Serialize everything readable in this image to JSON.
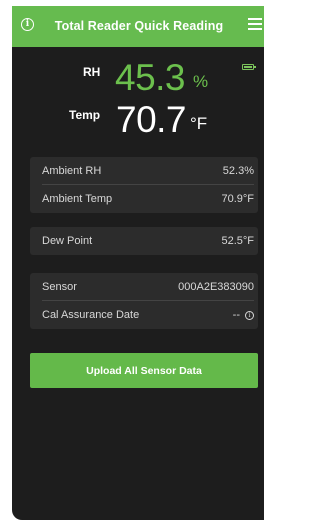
{
  "header": {
    "title": "Total Reader Quick Reading",
    "info_icon_glyph": "i"
  },
  "colors": {
    "header_green": "#66bb4f",
    "reading_green": "#6cc04d",
    "screen_bg": "#1d1d1d",
    "card_bg": "#2c2c2c",
    "button_green": "#64b94a"
  },
  "battery": {
    "icon": "battery-full-icon",
    "level": 1.0
  },
  "readings": {
    "rh_label": "RH",
    "rh_value": "45.3",
    "rh_unit": "%",
    "temp_label": "Temp",
    "temp_value": "70.7",
    "temp_unit": "°F"
  },
  "ambient": {
    "rh_label": "Ambient RH",
    "rh_value": "52.3%",
    "temp_label": "Ambient Temp",
    "temp_value": "70.9°F"
  },
  "dew_point": {
    "label": "Dew Point",
    "value": "52.5°F"
  },
  "sensor": {
    "label": "Sensor",
    "value": "000A2E383090",
    "cal_label": "Cal Assurance Date",
    "cal_value": "--",
    "cal_info_glyph": "i"
  },
  "upload_button_label": "Upload All Sensor Data"
}
